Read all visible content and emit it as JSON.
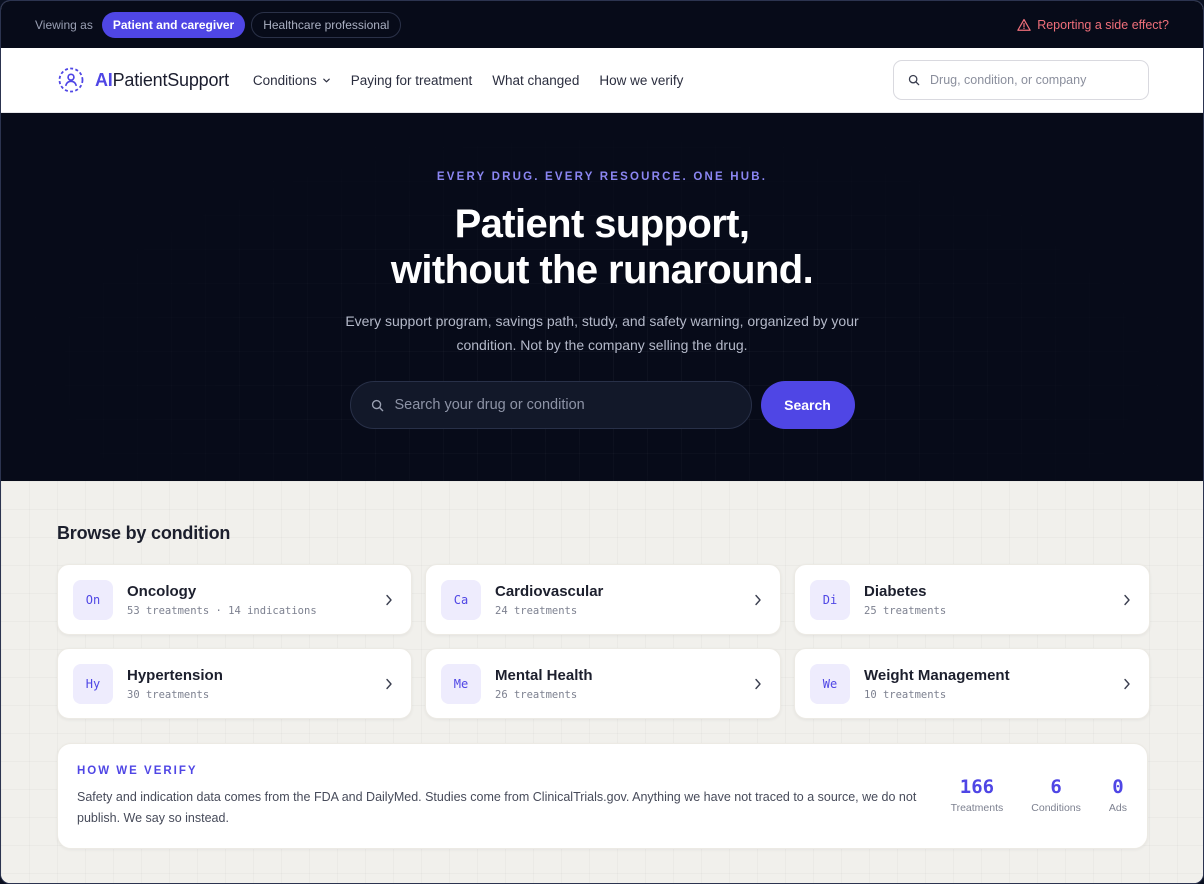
{
  "utility": {
    "viewing_as": "Viewing as",
    "audiences": [
      {
        "label": "Patient and caregiver",
        "active": true
      },
      {
        "label": "Healthcare professional",
        "active": false
      }
    ],
    "side_effect": "Reporting a side effect?"
  },
  "nav": {
    "logo_accent": "AI",
    "logo_rest": "PatientSupport",
    "links": [
      "Conditions",
      "Paying for treatment",
      "What changed",
      "How we verify"
    ],
    "search_placeholder": "Drug, condition, or company"
  },
  "hero": {
    "eyebrow": "EVERY DRUG. EVERY RESOURCE. ONE HUB.",
    "title_line1": "Patient support,",
    "title_line2": "without the runaround.",
    "subtitle": "Every support program, savings path, study, and safety warning, organized by your condition. Not by the company selling the drug.",
    "search_placeholder": "Search your drug or condition",
    "search_button": "Search"
  },
  "browse": {
    "title": "Browse by condition",
    "conditions": [
      {
        "abbr": "On",
        "name": "Oncology",
        "meta": "53 treatments · 14 indications"
      },
      {
        "abbr": "Ca",
        "name": "Cardiovascular",
        "meta": "24 treatments"
      },
      {
        "abbr": "Di",
        "name": "Diabetes",
        "meta": "25 treatments"
      },
      {
        "abbr": "Hy",
        "name": "Hypertension",
        "meta": "30 treatments"
      },
      {
        "abbr": "Me",
        "name": "Mental Health",
        "meta": "26 treatments"
      },
      {
        "abbr": "We",
        "name": "Weight Management",
        "meta": "10 treatments"
      }
    ]
  },
  "verify": {
    "label": "HOW WE VERIFY",
    "body": "Safety and indication data comes from the FDA and DailyMed. Studies come from ClinicalTrials.gov. Anything we have not traced to a source, we do not publish. We say so instead.",
    "stats": [
      {
        "value": "166",
        "label": "Treatments"
      },
      {
        "value": "6",
        "label": "Conditions"
      },
      {
        "value": "0",
        "label": "Ads"
      }
    ]
  },
  "colors": {
    "accent": "#4f46e5",
    "hero_bg": "#070b19",
    "warning": "#f06f7a"
  }
}
